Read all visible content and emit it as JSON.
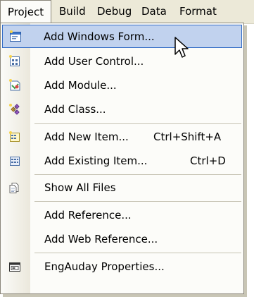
{
  "menubar": {
    "items": [
      {
        "label": "Project"
      },
      {
        "label": "Build"
      },
      {
        "label": "Debug"
      },
      {
        "label": "Data"
      },
      {
        "label": "Format"
      }
    ]
  },
  "menu": {
    "items": [
      {
        "label": "Add Windows Form...",
        "icon": "windows-form-icon"
      },
      {
        "label": "Add User Control...",
        "icon": "user-control-icon"
      },
      {
        "label": "Add Module...",
        "icon": "module-icon"
      },
      {
        "label": "Add Class...",
        "icon": "class-icon"
      },
      {
        "label": "Add New Item...",
        "shortcut": "Ctrl+Shift+A",
        "icon": "new-item-icon"
      },
      {
        "label": "Add Existing Item...",
        "shortcut": "Ctrl+D",
        "icon": "existing-item-icon"
      },
      {
        "label": "Show All Files",
        "icon": "show-all-files-icon"
      },
      {
        "label": "Add Reference..."
      },
      {
        "label": "Add Web Reference..."
      },
      {
        "label": "EngAuday Properties...",
        "icon": "properties-icon"
      }
    ]
  },
  "colors": {
    "highlight_fill": "#c1d2ee",
    "highlight_border": "#316ac5",
    "menubar_bg": "#ece9d8"
  }
}
